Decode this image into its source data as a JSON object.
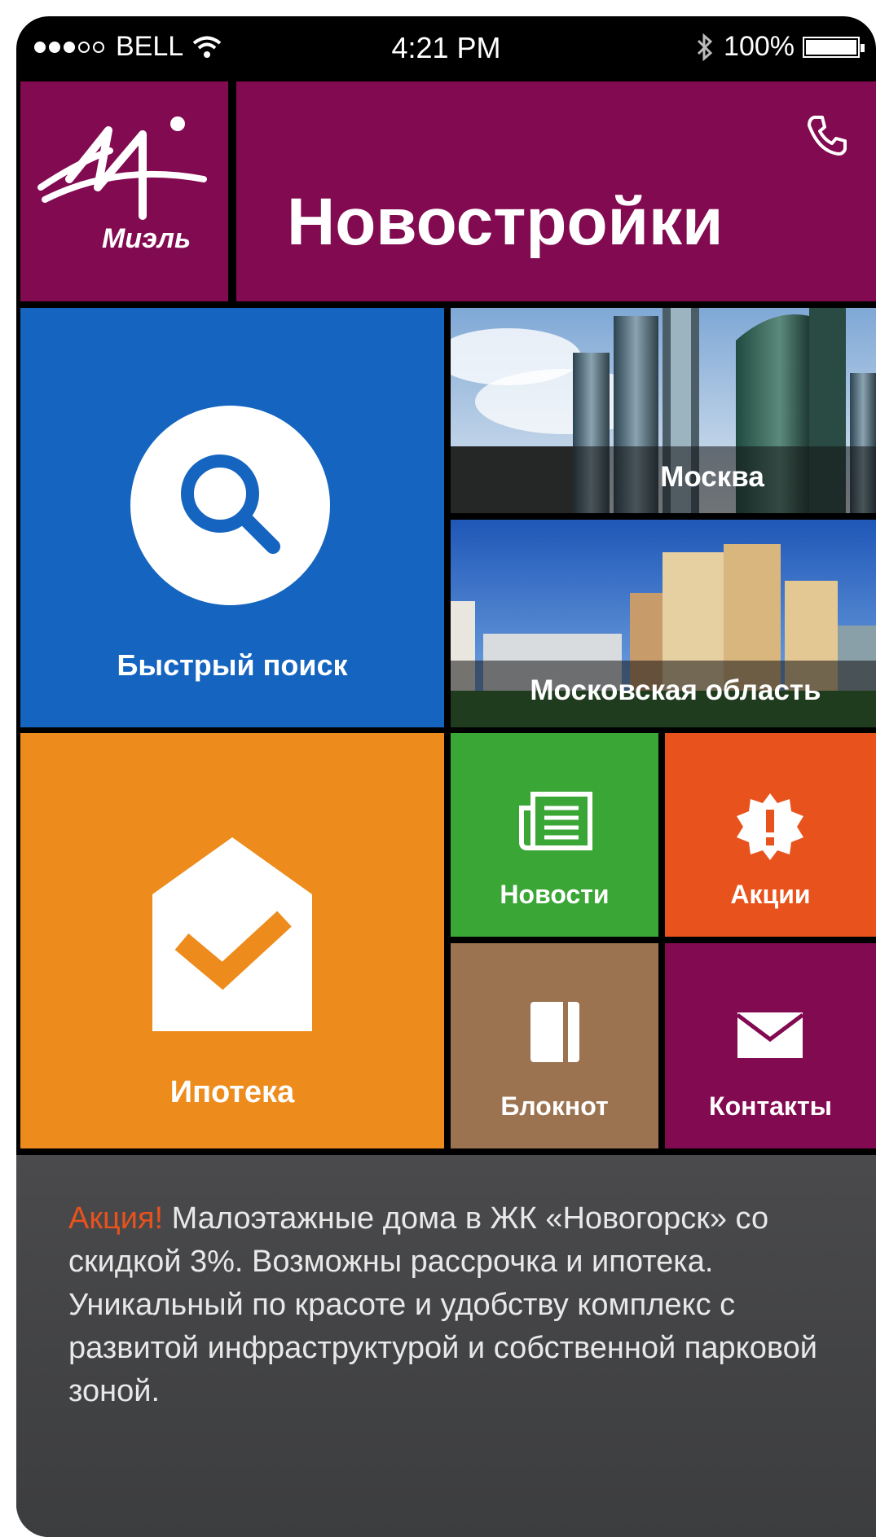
{
  "status_bar": {
    "carrier": "BELL",
    "time": "4:21 PM",
    "battery": "100%",
    "signal_dots_full": 3,
    "signal_dots_empty": 2
  },
  "header": {
    "logo_text": "Миэль",
    "title": "Новостройки"
  },
  "tiles": {
    "quick_search": "Быстрый поиск",
    "moscow": "Москва",
    "moscow_region": "Московская область",
    "mortgage": "Ипотека",
    "news": "Новости",
    "promos": "Акции",
    "notebook": "Блокнот",
    "contacts": "Контакты"
  },
  "promo_banner": {
    "highlight": "Акция!",
    "text": " Малоэтажные дома в ЖК «Новогорск» со скидкой 3%. Возможны рассрочка и ипотека. Уникальный по красоте и удобству комплекс с развитой инфраструктурой и собственной парковой зоной."
  },
  "colors": {
    "brand": "#820a50",
    "search": "#1565c0",
    "mortgage": "#ed8c1d",
    "news": "#3aa636",
    "promos": "#e8521c",
    "notebook": "#9c7350",
    "banner": "#434446"
  }
}
